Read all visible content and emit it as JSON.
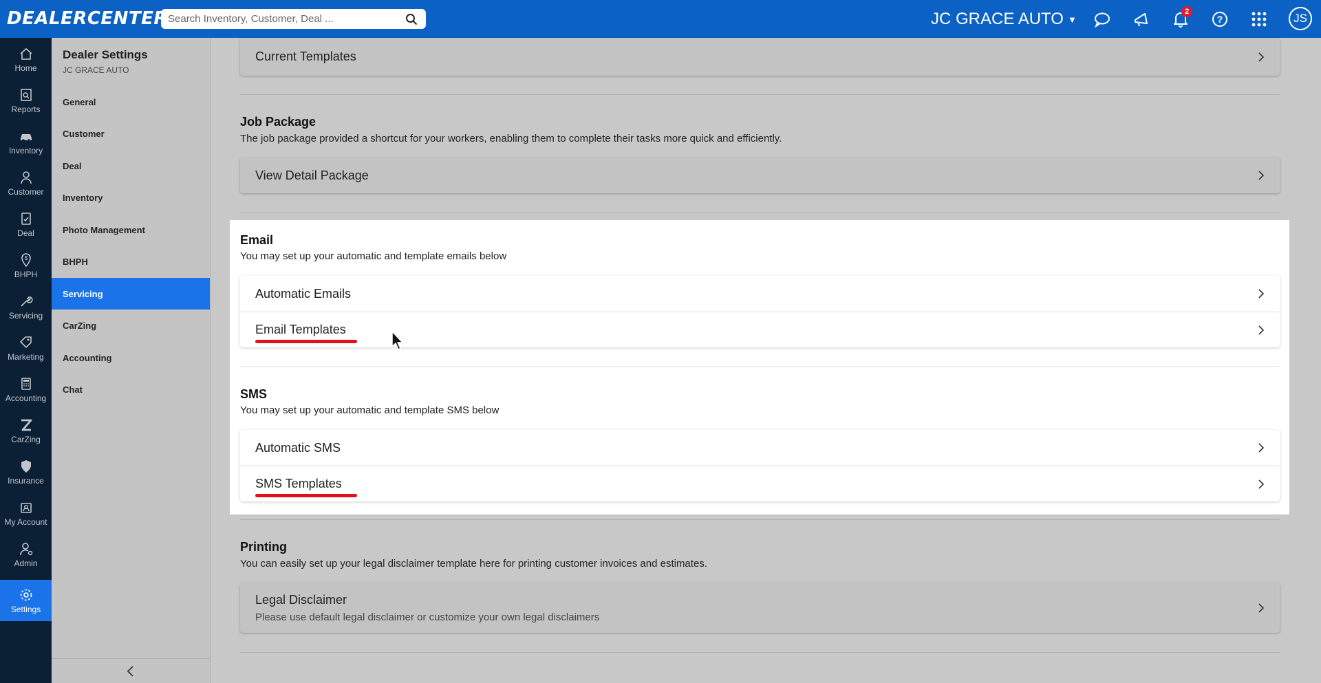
{
  "topbar": {
    "logo": "DEALERCENTER",
    "search_placeholder": "Search Inventory, Customer, Deal ...",
    "dealer_name": "JC GRACE AUTO",
    "notification_count": "2",
    "avatar_initials": "JS"
  },
  "nav": {
    "items": [
      {
        "label": "Home",
        "icon": "home-icon"
      },
      {
        "label": "Reports",
        "icon": "reports-icon"
      },
      {
        "label": "Inventory",
        "icon": "car-icon"
      },
      {
        "label": "Customer",
        "icon": "customer-icon"
      },
      {
        "label": "Deal",
        "icon": "deal-icon"
      },
      {
        "label": "BHPH",
        "icon": "bhph-icon"
      },
      {
        "label": "Servicing",
        "icon": "wrench-icon"
      },
      {
        "label": "Marketing",
        "icon": "tag-icon"
      },
      {
        "label": "Accounting",
        "icon": "calculator-icon"
      },
      {
        "label": "CarZing",
        "icon": "carzing-icon"
      },
      {
        "label": "Insurance",
        "icon": "shield-icon"
      },
      {
        "label": "My Account",
        "icon": "account-icon"
      },
      {
        "label": "Admin",
        "icon": "admin-icon"
      },
      {
        "label": "Settings",
        "icon": "gear-icon"
      }
    ],
    "active": "Settings"
  },
  "settings_panel": {
    "title": "Dealer Settings",
    "subtitle": "JC GRACE AUTO",
    "items": [
      "General",
      "Customer",
      "Deal",
      "Inventory",
      "Photo Management",
      "BHPH",
      "Servicing",
      "CarZing",
      "Accounting",
      "Chat"
    ],
    "active": "Servicing"
  },
  "main": {
    "current_templates": "Current Templates",
    "job_package": {
      "title": "Job Package",
      "description": "The job package provided a shortcut for your workers, enabling them to complete their tasks more quick and efficiently.",
      "row": "View Detail Package"
    },
    "email": {
      "title": "Email",
      "description": "You may set up your automatic and template emails below",
      "rows": [
        "Automatic Emails",
        "Email Templates"
      ]
    },
    "sms": {
      "title": "SMS",
      "description": "You may set up your automatic and template SMS below",
      "rows": [
        "Automatic SMS",
        "SMS Templates"
      ]
    },
    "printing": {
      "title": "Printing",
      "description": "You can easily set up your legal disclaimer template here for printing customer invoices and estimates.",
      "row_title": "Legal Disclaimer",
      "row_subtitle": "Please use default legal disclaimer or customize your own legal disclaimers"
    }
  },
  "colors": {
    "topbar": "#0b62c4",
    "nav": "#0c2035",
    "active": "#1a73e8",
    "annotation": "#e0111a"
  }
}
